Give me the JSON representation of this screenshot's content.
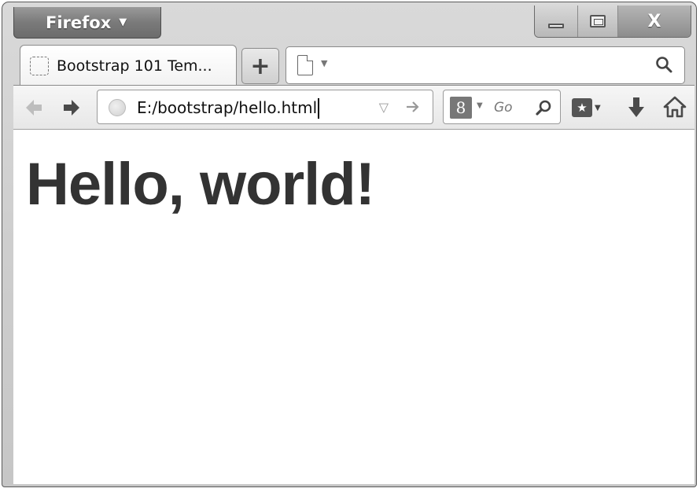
{
  "app_menu": {
    "label": "Firefox"
  },
  "tab": {
    "title": "Bootstrap 101 Tem..."
  },
  "toolbar": {
    "url": "E:/bootstrap/hello.html",
    "search_placeholder": "Go",
    "search_engine_glyph": "8"
  },
  "page": {
    "heading": "Hello, world!"
  },
  "icons": {
    "window_close": "X",
    "new_tab": "+",
    "bookmark_star": "★"
  }
}
